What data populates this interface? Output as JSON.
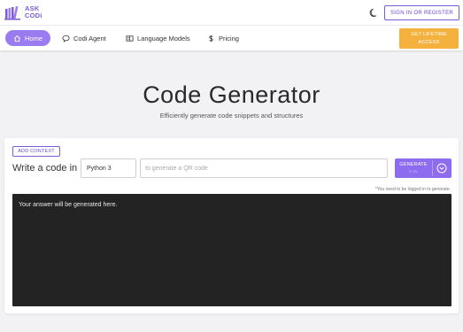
{
  "header": {
    "logo_line1": "ASK",
    "logo_line2": "CODi",
    "signin_label": "SIGN IN OR REGISTER"
  },
  "nav": {
    "items": [
      {
        "label": "Home",
        "icon": "home-icon"
      },
      {
        "label": "Codi Agent",
        "icon": "chat-bubble-icon"
      },
      {
        "label": "Language Models",
        "icon": "models-icon"
      },
      {
        "label": "Pricing",
        "icon": "dollar-icon"
      }
    ],
    "lifetime_line1": "GET LIFETIME",
    "lifetime_line2": "ACCESS"
  },
  "hero": {
    "title": "Code Generator",
    "subtitle": "Efficiently generate code snippets and structures"
  },
  "form": {
    "add_context_label": "ADD CONTEXT",
    "write_label": "Write a code in",
    "language_value": "Python 3",
    "prompt_placeholder": "to generate a QR code",
    "generate_label": "GENERATE",
    "generate_sublabel": "0.4s",
    "login_note": "*You need to be logged in to generate."
  },
  "output": {
    "placeholder": "Your answer will be generated here."
  },
  "colors": {
    "accent": "#8e6cf0",
    "accent_dark": "#6b46d4",
    "lifetime": "#f5b13d",
    "output_bg": "#232323"
  }
}
